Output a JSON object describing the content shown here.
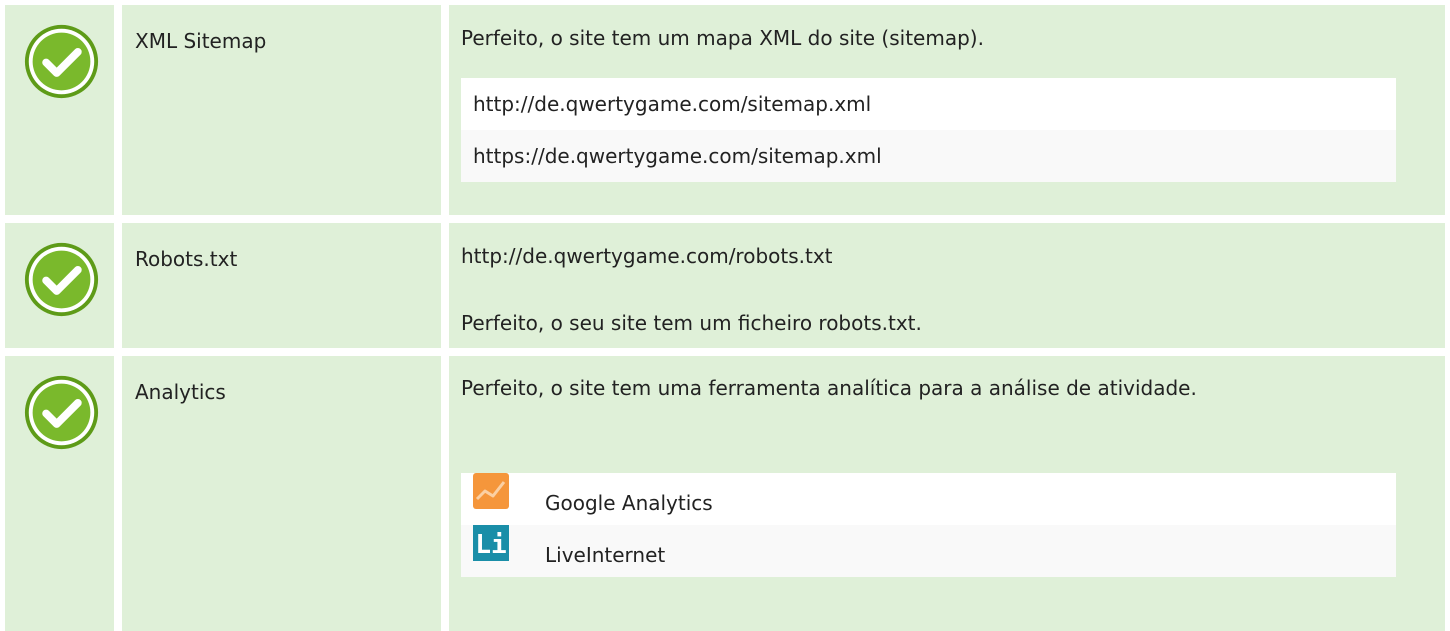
{
  "status_icon": "check-circle-icon",
  "colors": {
    "row_bg": "#dff0d8",
    "check_green": "#7ab92c",
    "analytics_orange": "#f5963b",
    "liveinternet_teal": "#1a8ea8"
  },
  "rows": [
    {
      "label": "XML Sitemap",
      "message": "Perfeito, o site tem um mapa XML do site (sitemap).",
      "items": [
        "http://de.qwertygame.com/sitemap.xml",
        "https://de.qwertygame.com/sitemap.xml"
      ]
    },
    {
      "label": "Robots.txt",
      "url": "http://de.qwertygame.com/robots.txt",
      "message": "Perfeito, o seu site tem um ficheiro robots.txt."
    },
    {
      "label": "Analytics",
      "message": "Perfeito, o site tem uma ferramenta analítica para a análise de atividade.",
      "tools": [
        {
          "name": "Google Analytics",
          "icon": "google-analytics-icon"
        },
        {
          "name": "LiveInternet",
          "icon": "liveinternet-icon",
          "icon_text": "Li"
        }
      ]
    }
  ]
}
